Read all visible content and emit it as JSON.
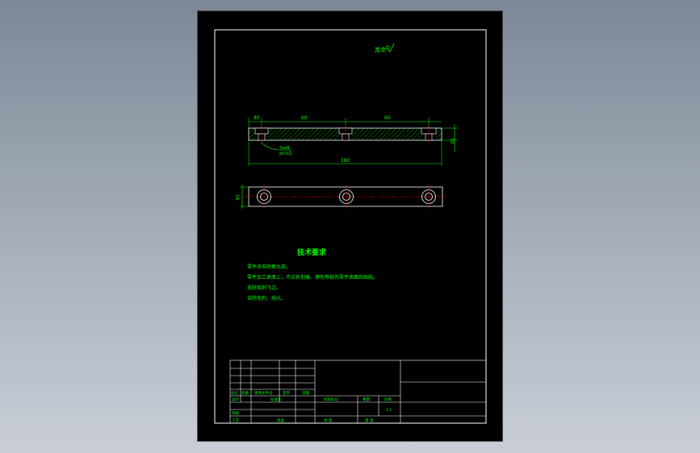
{
  "drawing": {
    "surface_finish_note": "其余",
    "dimensions": {
      "left_offset": "80",
      "span_1": "60",
      "span_2": "60",
      "overall_length": "180",
      "height": "10",
      "width": "16"
    },
    "hole_callout": {
      "line1": "3xø8",
      "line2": "ø5沉孔"
    }
  },
  "tech_requirements": {
    "title": "技术要求",
    "items": [
      "零件须去除氧化皮。",
      "零件加工表面上，不应有划痕、擦伤等损伤零件表面的缺陷。",
      "去除毛刺飞边。",
      "去除毛刺，抛光。"
    ]
  },
  "title_block": {
    "row_labels": [
      "标记",
      "处数",
      "更改文件号",
      "签字",
      "日期"
    ],
    "design_label": "设计",
    "standardization_label": "标准化",
    "stage_label": "阶段标记",
    "weight_label": "重量",
    "scale_label": "比例",
    "scale_value": "1:1",
    "review_label": "审核",
    "process_label": "工艺",
    "approve_label": "批准",
    "sheet_total_label": "共  张",
    "sheet_no_label": "第  张"
  },
  "colors": {
    "line": "#ffffff",
    "text": "#00ff00",
    "center": "#ff0000",
    "dimension": "#00ff00",
    "hatch": "#00ff00",
    "background": "#000000"
  }
}
